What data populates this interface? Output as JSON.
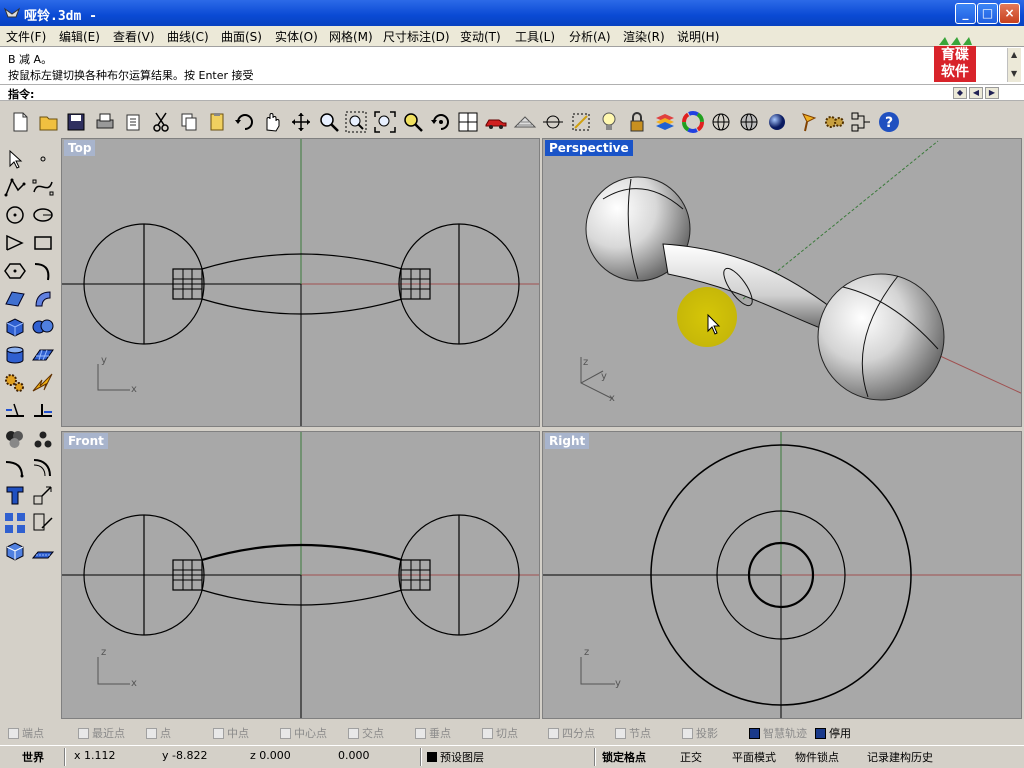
{
  "window": {
    "title": "哑铃.3dm -",
    "minimize": "_",
    "maximize": "□",
    "close": "×"
  },
  "menu": {
    "items": [
      "文件(F)",
      "编辑(E)",
      "查看(V)",
      "曲线(C)",
      "曲面(S)",
      "实体(O)",
      "网格(M)",
      "尺寸标注(D)",
      "变动(T)",
      "工具(L)",
      "分析(A)",
      "渲染(R)",
      "说明(H)"
    ]
  },
  "history": {
    "line1": "B 减 A。",
    "line2": "按鼠标左键切换各种布尔运算结果。按 Enter 接受"
  },
  "logo": {
    "text_line1": "育碟",
    "text_line2": "软件",
    "color": "#d8232a"
  },
  "command": {
    "label": "指令:",
    "value": ""
  },
  "toolbar": {
    "icons": [
      "new-icon",
      "open-icon",
      "save-icon",
      "print-icon",
      "import-icon",
      "cut-icon",
      "copy-icon",
      "paste-icon",
      "undo-icon",
      "pan-icon",
      "rotate-view-icon",
      "zoom-icon",
      "zoom-window-icon",
      "zoom-extents-icon",
      "zoom-selected-icon",
      "undo-view-icon",
      "four-viewports-icon",
      "car-icon",
      "grid-plane-icon",
      "osnap-icon",
      "point-icon",
      "light-icon",
      "lock-icon",
      "layer-icon",
      "color-wheel-icon",
      "wireframe-icon",
      "shaded-icon",
      "render-icon",
      "lamp-icon",
      "settings-icon",
      "options-icon",
      "help-icon"
    ]
  },
  "left_tools": {
    "icons": [
      "select-icon",
      "point-icon",
      "polyline-icon",
      "curve-icon",
      "circle-icon",
      "ellipse-icon",
      "arc-icon",
      "rectangle-icon",
      "polygon-icon",
      "freeform-icon",
      "surface-icon",
      "sweep-icon",
      "box-icon",
      "sphere-icon",
      "cylinder-icon",
      "mesh-icon",
      "transform-icon",
      "explode-icon",
      "trim-icon",
      "split-icon",
      "boolean-icon",
      "group-icon",
      "fillet-icon",
      "offset-icon",
      "text-icon",
      "scale-icon",
      "array-icon",
      "dimension-icon",
      "solid-edit-icon",
      "construction-icon"
    ]
  },
  "viewports": {
    "top": "Top",
    "perspective": "Perspective",
    "front": "Front",
    "right": "Right"
  },
  "axes": {
    "x": "x",
    "y": "y",
    "z": "z"
  },
  "osnaps": [
    {
      "label": "端点",
      "checked": true
    },
    {
      "label": "最近点",
      "checked": false
    },
    {
      "label": "点",
      "checked": false
    },
    {
      "label": "中点",
      "checked": false
    },
    {
      "label": "中心点",
      "checked": false
    },
    {
      "label": "交点",
      "checked": false
    },
    {
      "label": "垂点",
      "checked": false
    },
    {
      "label": "切点",
      "checked": false
    },
    {
      "label": "四分点",
      "checked": false
    },
    {
      "label": "节点",
      "checked": false
    },
    {
      "label": "投影",
      "checked": false
    },
    {
      "label": "智慧轨迹",
      "checked": true
    },
    {
      "label": "停用",
      "checked": true
    }
  ],
  "status": {
    "cplane": "世界",
    "x": "x 1.112",
    "y": "y -8.822",
    "z": "z 0.000",
    "extra": "0.000",
    "layer": "预设图层",
    "grid_snap": "锁定格点",
    "ortho": "正交",
    "planar": "平面模式",
    "osnap": "物件锁点",
    "history": "记录建构历史"
  }
}
